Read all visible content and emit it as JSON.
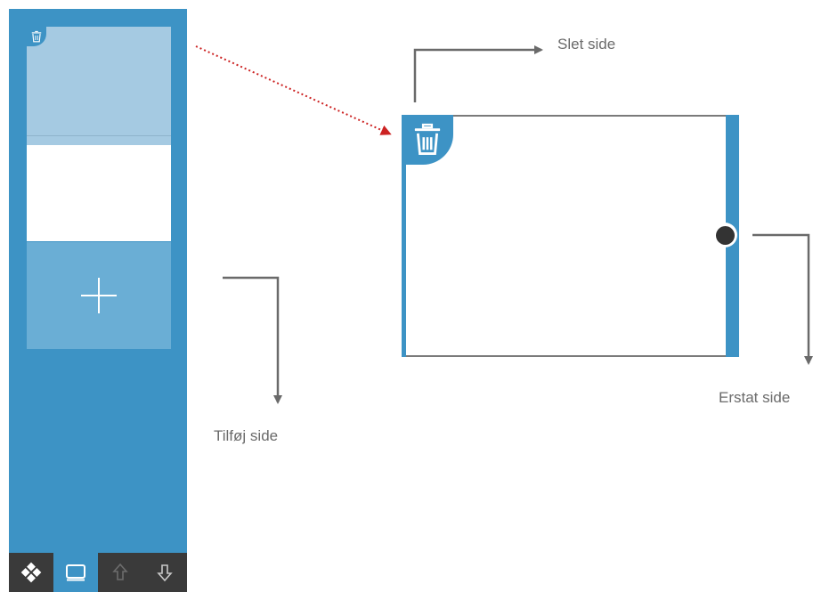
{
  "colors": {
    "accent": "#3d93c5",
    "thumb_selected": "#a5cae2",
    "add_tile": "#6aaed5",
    "toolbar": "#3a3a3a",
    "annotation_line": "#6a6a6a",
    "annotation_dotted": "#cc2222"
  },
  "sidebar": {
    "thumbnails": [
      {
        "state": "selected",
        "icon": "trash-icon"
      },
      {
        "state": "normal"
      }
    ],
    "add_tile_icon": "plus-icon"
  },
  "toolbar": {
    "buttons": [
      {
        "icon": "puzzle-diamond-icon",
        "active": false
      },
      {
        "icon": "screen-icon",
        "active": true
      },
      {
        "icon": "arrow-up-icon",
        "active": false
      },
      {
        "icon": "arrow-down-icon",
        "active": false
      }
    ]
  },
  "preview": {
    "delete_icon": "trash-icon",
    "replace_handle_icon": "circle-handle-icon"
  },
  "annotations": {
    "delete_label": "Slet side",
    "replace_label": "Erstat side",
    "add_label": "Tilføj side"
  }
}
